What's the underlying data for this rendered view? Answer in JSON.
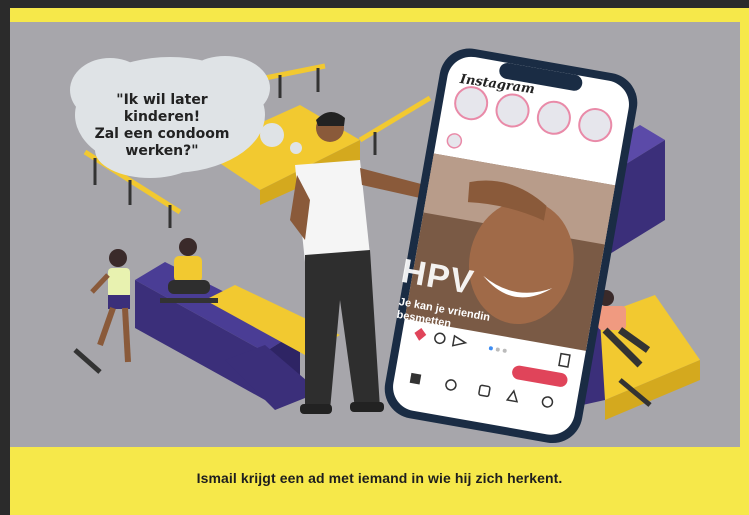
{
  "speech_bubble": {
    "lines": [
      "\"Ik wil later kinderen!",
      "Zal een condoom",
      "werken?\""
    ]
  },
  "phone": {
    "app_name": "Instagram",
    "ad_title": "HPV",
    "ad_subtitle_lines": [
      "Je kan je vriendin",
      "besmetten"
    ]
  },
  "caption": "Ismail krijgt een ad met iemand in wie hij zich herkent.",
  "colors": {
    "accent_yellow": "#f6e84a",
    "background_grey": "#a7a6ab",
    "ramp_purple": "#3b2f7a",
    "border_dark": "#2b2b2b",
    "like_red": "#e0445a"
  }
}
